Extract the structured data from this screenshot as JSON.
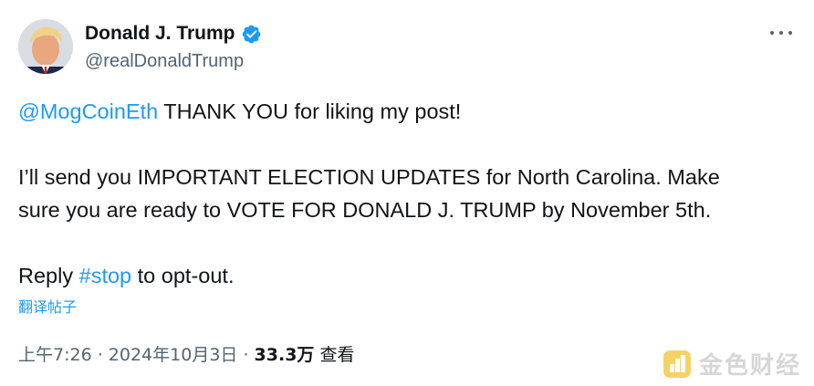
{
  "author": {
    "display_name": "Donald J. Trump",
    "handle": "@realDonaldTrump",
    "verified": true
  },
  "tweet": {
    "line1_mention": "@MogCoinEth",
    "line1_text": " THANK YOU for liking my post!",
    "line2": "I’ll send you IMPORTANT ELECTION UPDATES for North Carolina. Make",
    "line3": "sure you are ready to VOTE FOR DONALD J. TRUMP by November 5th.",
    "line4_prefix": "Reply ",
    "line4_hashtag": "#stop",
    "line4_suffix": " to opt-out."
  },
  "translate_label": "翻译帖子",
  "meta": {
    "time": "上午7:26",
    "separator1": " · ",
    "date": "2024年10月3日",
    "separator2": " · ",
    "views_count": "33.3万",
    "views_label": " 查看"
  },
  "watermark": {
    "text": "金色财经"
  },
  "colors": {
    "link": "#1d9bf0",
    "text": "#0f1419",
    "secondary": "#536471",
    "verified": "#1d9bf0"
  },
  "icons": {
    "more": "more-horizontal-icon",
    "verified": "verified-badge-icon"
  }
}
